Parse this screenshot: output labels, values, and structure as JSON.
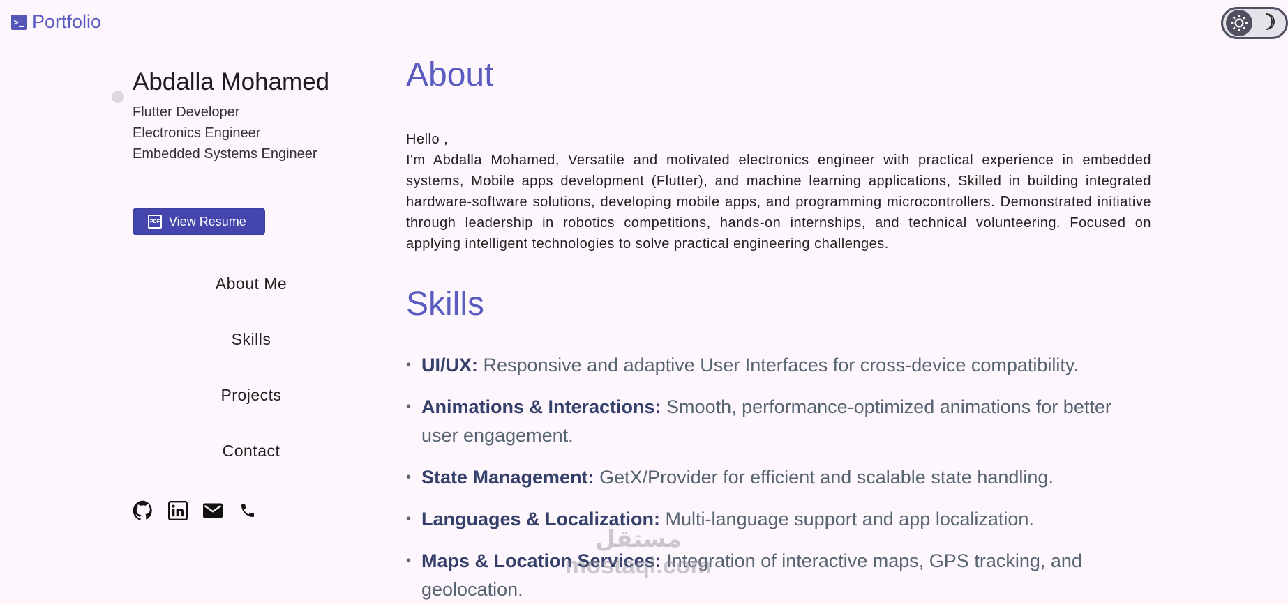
{
  "header": {
    "brand_title": "Portfolio",
    "brand_icon": "terminal-icon",
    "theme_toggle": {
      "light_icon": "sun-icon",
      "dark_icon": "moon-icon"
    }
  },
  "profile": {
    "name": "Abdalla Mohamed",
    "roles": [
      "Flutter Developer",
      "Electronics Engineer",
      "Embedded Systems Engineer"
    ],
    "resume_button": "View Resume"
  },
  "nav": [
    "About Me",
    "Skills",
    "Projects",
    "Contact"
  ],
  "socials": [
    "github-icon",
    "linkedin-icon",
    "email-icon",
    "phone-icon"
  ],
  "about": {
    "title": "About",
    "greeting": "Hello ,",
    "body": "I'm Abdalla Mohamed, Versatile and motivated electronics engineer with practical experience in embedded systems, Mobile apps development (Flutter), and machine learning applications, Skilled in building integrated hardware-software solutions, developing mobile apps, and programming microcontrollers. Demonstrated initiative through leadership in robotics competitions, hands-on internships, and technical volunteering. Focused on applying intelligent technologies to solve practical engineering challenges."
  },
  "skills": {
    "title": "Skills",
    "items": [
      {
        "name": "UI/UX:",
        "desc": " Responsive and adaptive User Interfaces for cross-device compatibility."
      },
      {
        "name": "Animations & Interactions:",
        "desc": " Smooth, performance-optimized animations for better user engagement."
      },
      {
        "name": "State Management:",
        "desc": " GetX/Provider  for efficient and scalable state handling."
      },
      {
        "name": "Languages & Localization:",
        "desc": " Multi-language support and app localization."
      },
      {
        "name": "Maps & Location Services:",
        "desc": " Integration of interactive maps, GPS tracking, and geolocation."
      }
    ]
  },
  "watermark": {
    "arabic": "مستقل",
    "latin": "mostaql.com"
  },
  "colors": {
    "accent": "#5b5cc0",
    "button": "#4546ad",
    "background": "#fdf7fd"
  }
}
